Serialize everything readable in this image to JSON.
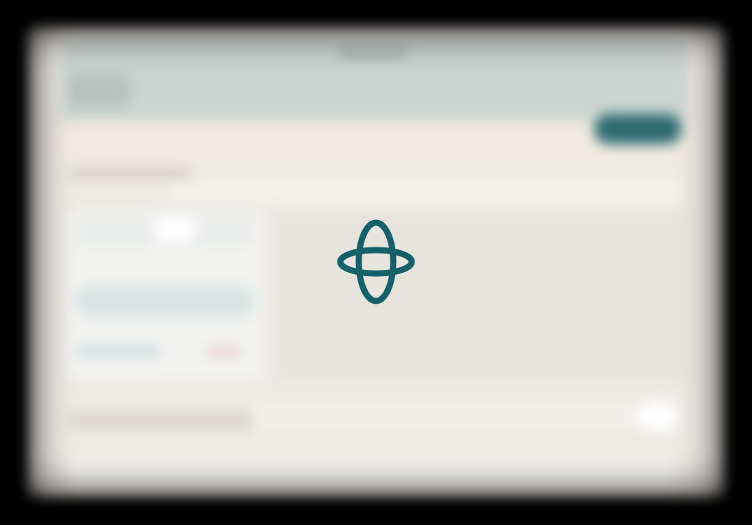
{
  "overlay": {
    "state": "loading",
    "icon": "orbit-loader-icon",
    "accent_color": "#14616a"
  },
  "background": {
    "frame_color": "#000000",
    "window_color": "#ede9e4",
    "header_color": "#ccd4d1",
    "primary_button_color": "#2e6c72"
  }
}
